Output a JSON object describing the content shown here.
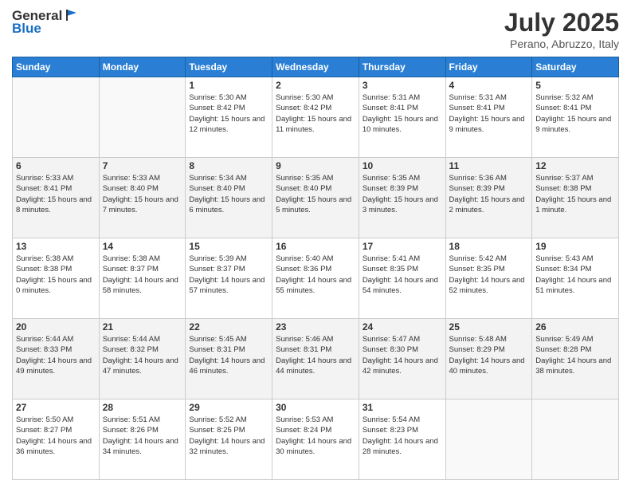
{
  "header": {
    "logo_general": "General",
    "logo_blue": "Blue",
    "title": "July 2025",
    "subtitle": "Perano, Abruzzo, Italy"
  },
  "days_of_week": [
    "Sunday",
    "Monday",
    "Tuesday",
    "Wednesday",
    "Thursday",
    "Friday",
    "Saturday"
  ],
  "weeks": [
    [
      {
        "day": "",
        "info": ""
      },
      {
        "day": "",
        "info": ""
      },
      {
        "day": "1",
        "info": "Sunrise: 5:30 AM\nSunset: 8:42 PM\nDaylight: 15 hours and 12 minutes."
      },
      {
        "day": "2",
        "info": "Sunrise: 5:30 AM\nSunset: 8:42 PM\nDaylight: 15 hours and 11 minutes."
      },
      {
        "day": "3",
        "info": "Sunrise: 5:31 AM\nSunset: 8:41 PM\nDaylight: 15 hours and 10 minutes."
      },
      {
        "day": "4",
        "info": "Sunrise: 5:31 AM\nSunset: 8:41 PM\nDaylight: 15 hours and 9 minutes."
      },
      {
        "day": "5",
        "info": "Sunrise: 5:32 AM\nSunset: 8:41 PM\nDaylight: 15 hours and 9 minutes."
      }
    ],
    [
      {
        "day": "6",
        "info": "Sunrise: 5:33 AM\nSunset: 8:41 PM\nDaylight: 15 hours and 8 minutes."
      },
      {
        "day": "7",
        "info": "Sunrise: 5:33 AM\nSunset: 8:40 PM\nDaylight: 15 hours and 7 minutes."
      },
      {
        "day": "8",
        "info": "Sunrise: 5:34 AM\nSunset: 8:40 PM\nDaylight: 15 hours and 6 minutes."
      },
      {
        "day": "9",
        "info": "Sunrise: 5:35 AM\nSunset: 8:40 PM\nDaylight: 15 hours and 5 minutes."
      },
      {
        "day": "10",
        "info": "Sunrise: 5:35 AM\nSunset: 8:39 PM\nDaylight: 15 hours and 3 minutes."
      },
      {
        "day": "11",
        "info": "Sunrise: 5:36 AM\nSunset: 8:39 PM\nDaylight: 15 hours and 2 minutes."
      },
      {
        "day": "12",
        "info": "Sunrise: 5:37 AM\nSunset: 8:38 PM\nDaylight: 15 hours and 1 minute."
      }
    ],
    [
      {
        "day": "13",
        "info": "Sunrise: 5:38 AM\nSunset: 8:38 PM\nDaylight: 15 hours and 0 minutes."
      },
      {
        "day": "14",
        "info": "Sunrise: 5:38 AM\nSunset: 8:37 PM\nDaylight: 14 hours and 58 minutes."
      },
      {
        "day": "15",
        "info": "Sunrise: 5:39 AM\nSunset: 8:37 PM\nDaylight: 14 hours and 57 minutes."
      },
      {
        "day": "16",
        "info": "Sunrise: 5:40 AM\nSunset: 8:36 PM\nDaylight: 14 hours and 55 minutes."
      },
      {
        "day": "17",
        "info": "Sunrise: 5:41 AM\nSunset: 8:35 PM\nDaylight: 14 hours and 54 minutes."
      },
      {
        "day": "18",
        "info": "Sunrise: 5:42 AM\nSunset: 8:35 PM\nDaylight: 14 hours and 52 minutes."
      },
      {
        "day": "19",
        "info": "Sunrise: 5:43 AM\nSunset: 8:34 PM\nDaylight: 14 hours and 51 minutes."
      }
    ],
    [
      {
        "day": "20",
        "info": "Sunrise: 5:44 AM\nSunset: 8:33 PM\nDaylight: 14 hours and 49 minutes."
      },
      {
        "day": "21",
        "info": "Sunrise: 5:44 AM\nSunset: 8:32 PM\nDaylight: 14 hours and 47 minutes."
      },
      {
        "day": "22",
        "info": "Sunrise: 5:45 AM\nSunset: 8:31 PM\nDaylight: 14 hours and 46 minutes."
      },
      {
        "day": "23",
        "info": "Sunrise: 5:46 AM\nSunset: 8:31 PM\nDaylight: 14 hours and 44 minutes."
      },
      {
        "day": "24",
        "info": "Sunrise: 5:47 AM\nSunset: 8:30 PM\nDaylight: 14 hours and 42 minutes."
      },
      {
        "day": "25",
        "info": "Sunrise: 5:48 AM\nSunset: 8:29 PM\nDaylight: 14 hours and 40 minutes."
      },
      {
        "day": "26",
        "info": "Sunrise: 5:49 AM\nSunset: 8:28 PM\nDaylight: 14 hours and 38 minutes."
      }
    ],
    [
      {
        "day": "27",
        "info": "Sunrise: 5:50 AM\nSunset: 8:27 PM\nDaylight: 14 hours and 36 minutes."
      },
      {
        "day": "28",
        "info": "Sunrise: 5:51 AM\nSunset: 8:26 PM\nDaylight: 14 hours and 34 minutes."
      },
      {
        "day": "29",
        "info": "Sunrise: 5:52 AM\nSunset: 8:25 PM\nDaylight: 14 hours and 32 minutes."
      },
      {
        "day": "30",
        "info": "Sunrise: 5:53 AM\nSunset: 8:24 PM\nDaylight: 14 hours and 30 minutes."
      },
      {
        "day": "31",
        "info": "Sunrise: 5:54 AM\nSunset: 8:23 PM\nDaylight: 14 hours and 28 minutes."
      },
      {
        "day": "",
        "info": ""
      },
      {
        "day": "",
        "info": ""
      }
    ]
  ]
}
